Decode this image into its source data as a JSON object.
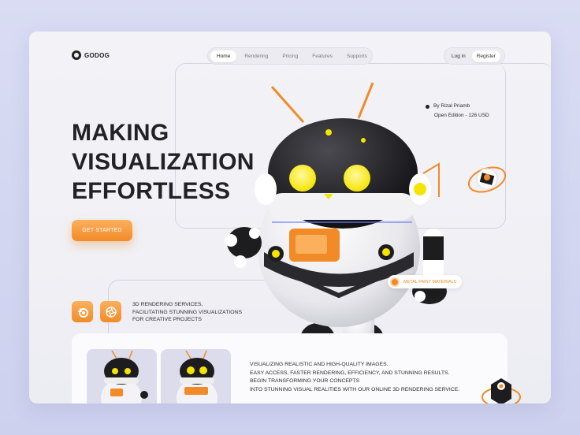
{
  "brand": {
    "name": "GODOG"
  },
  "nav": {
    "items": [
      {
        "label": "Home",
        "active": true
      },
      {
        "label": "Rendering",
        "active": false
      },
      {
        "label": "Pricing",
        "active": false
      },
      {
        "label": "Features",
        "active": false
      },
      {
        "label": "Supports",
        "active": false
      }
    ]
  },
  "auth": {
    "login": "Log in",
    "register": "Register"
  },
  "hero": {
    "headline": [
      "MAKING",
      "VISUALIZATION",
      "EFFORTLESS"
    ],
    "cta": "GET STARTED"
  },
  "author": {
    "by": "By Rizal Priamb",
    "edition": "Open Edition - 126 USD"
  },
  "services": {
    "lines": [
      "3D RENDERING SERVICES,",
      "FACILITATING STUNNING VISUALIZATIONS",
      "FOR CREATIVE PROJECTS"
    ],
    "icons": [
      "blender-icon",
      "aperture-icon"
    ]
  },
  "material_tag": {
    "label": "METAL PAINT MATERIALS"
  },
  "description": {
    "lines": [
      "VISUALIZING REALISTIC AND HIGH-QUALITY IMAGES.",
      "EASY ACCESS, FASTER RENDERING, EFFICIENCY, AND STUNNING RESULTS.",
      "BEGIN TRANSFORMING YOUR CONCEPTS",
      "INTO STUNNING VISUAL REALITIES WITH OUR ONLINE 3D RENDERING SERVICE."
    ]
  },
  "colors": {
    "accent": "#f28a27",
    "accent_light": "#fbb05d",
    "text": "#222226",
    "eye": "#f5e400"
  }
}
